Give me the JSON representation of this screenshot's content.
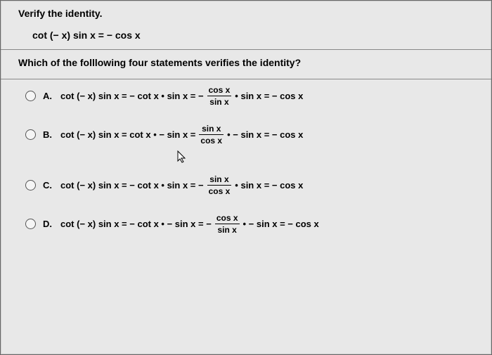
{
  "prompt": "Verify the identity.",
  "identity": "cot (− x) sin x = − cos x",
  "sub_prompt": "Which of the folllowing four statements verifies the identity?",
  "options": [
    {
      "letter": "A.",
      "p1": "cot (− x) sin x = − cot x • sin x = −",
      "num": "cos x",
      "den": "sin x",
      "p2": " • sin x = − cos x"
    },
    {
      "letter": "B.",
      "p1": "cot (− x) sin x = cot x • − sin x =",
      "num": "sin x",
      "den": "cos x",
      "p2": " • − sin x = − cos x"
    },
    {
      "letter": "C.",
      "p1": "cot (− x) sin x = − cot x • sin x = −",
      "num": "sin x",
      "den": "cos x",
      "p2": " • sin x = − cos x"
    },
    {
      "letter": "D.",
      "p1": "cot (− x) sin x = − cot x • − sin x = −",
      "num": "cos x",
      "den": "sin x",
      "p2": " • − sin x = − cos x"
    }
  ]
}
